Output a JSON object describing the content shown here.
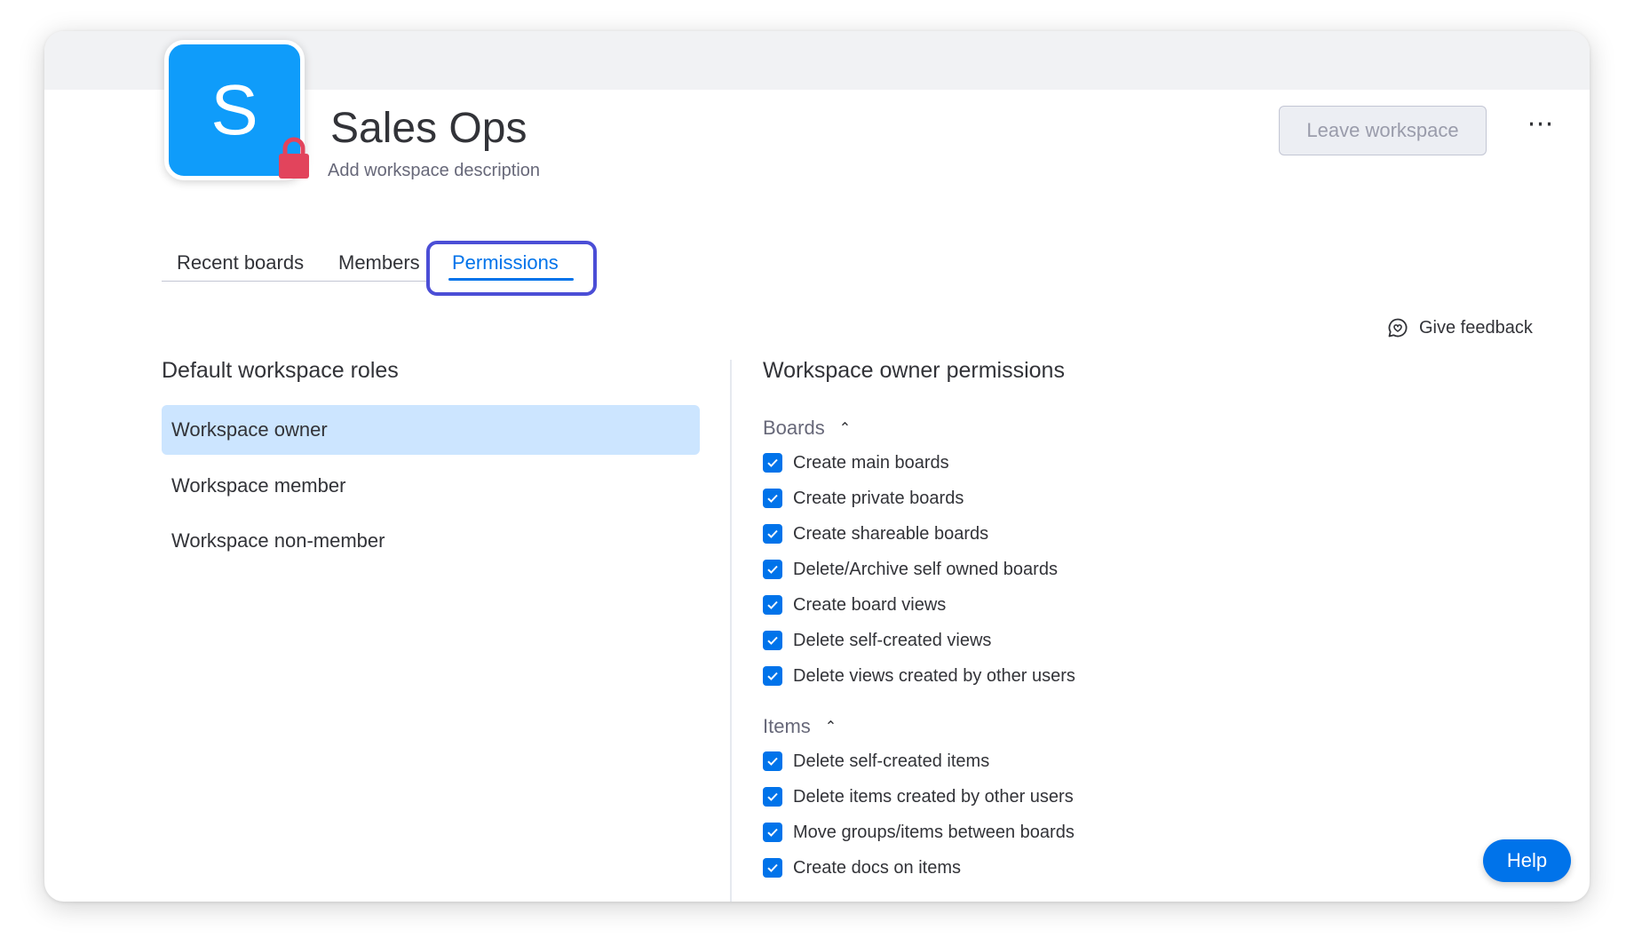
{
  "workspace": {
    "initial": "S",
    "title": "Sales Ops",
    "description_placeholder": "Add workspace description",
    "color": "#0f9cfa",
    "lock_color": "#e2445c"
  },
  "header": {
    "leave_label": "Leave workspace",
    "more_label": "⋯"
  },
  "tabs": [
    {
      "label": "Recent boards"
    },
    {
      "label": "Members"
    },
    {
      "label": "Permissions",
      "active": true
    }
  ],
  "feedback_label": "Give feedback",
  "roles": {
    "title": "Default workspace roles",
    "items": [
      {
        "label": "Workspace owner",
        "selected": true
      },
      {
        "label": "Workspace member"
      },
      {
        "label": "Workspace non-member"
      }
    ]
  },
  "permissions": {
    "title": "Workspace owner permissions",
    "sections": [
      {
        "name": "Boards",
        "expanded": true,
        "items": [
          {
            "label": "Create main boards",
            "checked": true
          },
          {
            "label": "Create private boards",
            "checked": true
          },
          {
            "label": "Create shareable boards",
            "checked": true
          },
          {
            "label": "Delete/Archive self owned boards",
            "checked": true
          },
          {
            "label": "Create board views",
            "checked": true
          },
          {
            "label": "Delete self-created views",
            "checked": true
          },
          {
            "label": "Delete views created by other users",
            "checked": true
          }
        ]
      },
      {
        "name": "Items",
        "expanded": true,
        "items": [
          {
            "label": "Delete self-created items",
            "checked": true
          },
          {
            "label": "Delete items created by other users",
            "checked": true
          },
          {
            "label": "Move groups/items between boards",
            "checked": true
          },
          {
            "label": "Create docs on items",
            "checked": true
          }
        ]
      }
    ]
  },
  "help_label": "Help",
  "accent_color": "#0073ea",
  "highlight_color": "#4b4ed6"
}
